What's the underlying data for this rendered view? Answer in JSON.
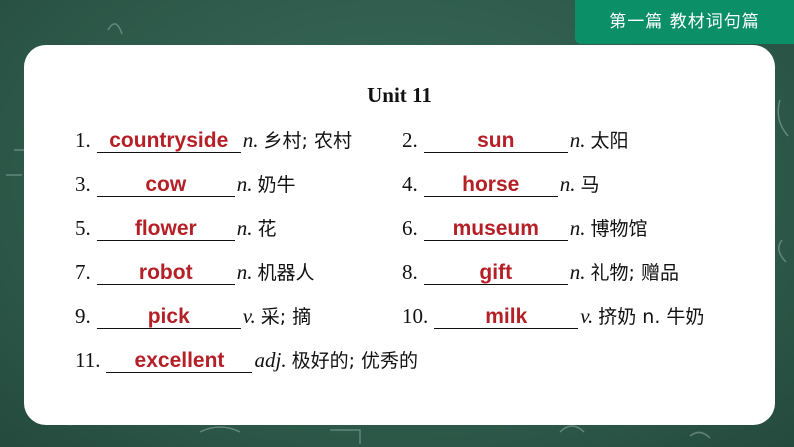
{
  "banner": {
    "text": "第一篇  教材词句篇"
  },
  "title": "Unit 11",
  "items": [
    {
      "num": "1.",
      "answer": "countryside",
      "pos": "n.",
      "meaning": "乡村; 农村"
    },
    {
      "num": "2.",
      "answer": "sun",
      "pos": "n.",
      "meaning": "太阳"
    },
    {
      "num": "3.",
      "answer": "cow",
      "pos": "n.",
      "meaning": "奶牛"
    },
    {
      "num": "4.",
      "answer": "horse",
      "pos": "n.",
      "meaning": "马"
    },
    {
      "num": "5.",
      "answer": "flower",
      "pos": "n.",
      "meaning": "花"
    },
    {
      "num": "6.",
      "answer": "museum",
      "pos": "n.",
      "meaning": "博物馆"
    },
    {
      "num": "7.",
      "answer": "robot",
      "pos": "n.",
      "meaning": "机器人"
    },
    {
      "num": "8.",
      "answer": "gift",
      "pos": "n.",
      "meaning": "礼物; 赠品"
    },
    {
      "num": "9.",
      "answer": "pick",
      "pos": "v.",
      "meaning": "采; 摘"
    },
    {
      "num": "10.",
      "answer": "milk",
      "pos": "v.",
      "meaning": "挤奶 n. 牛奶"
    },
    {
      "num": "11.",
      "answer": "excellent",
      "pos": "adj.",
      "meaning": "极好的; 优秀的"
    }
  ],
  "colors": {
    "board": "#2f5d4f",
    "banner": "#0a8f66",
    "answer": "#b51f26"
  }
}
